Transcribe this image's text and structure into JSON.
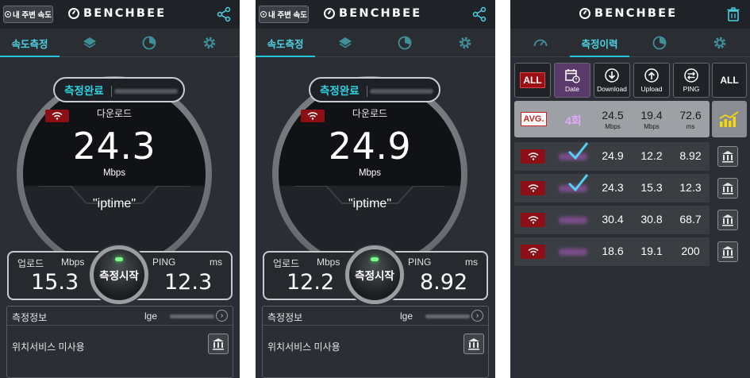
{
  "app": {
    "brand": "BENCHBEE"
  },
  "screens": [
    {
      "nearby_label": "내 주변 속도",
      "tab_speed": "속도측정",
      "badge_text": "측정완료",
      "download_label": "다운로드",
      "download_value": "24.3",
      "download_unit": "Mbps",
      "ssid": "\"iptime\"",
      "upload_label": "업로드",
      "upload_unit": "Mbps",
      "upload_value": "15.3",
      "ping_label": "PING",
      "ping_unit": "ms",
      "ping_value": "12.3",
      "start_label": "측정시작",
      "info_title": "측정정보",
      "info_device": "lge",
      "location_text": "위치서비스 미사용"
    },
    {
      "nearby_label": "내 주변 속도",
      "tab_speed": "속도측정",
      "badge_text": "측정완료",
      "download_label": "다운로드",
      "download_value": "24.9",
      "download_unit": "Mbps",
      "ssid": "\"iptime\"",
      "upload_label": "업로드",
      "upload_unit": "Mbps",
      "upload_value": "12.2",
      "ping_label": "PING",
      "ping_unit": "ms",
      "ping_value": "8.92",
      "start_label": "측정시작",
      "info_title": "측정정보",
      "info_device": "lge",
      "location_text": "위치서비스 미사용"
    }
  ],
  "history": {
    "tab_history": "측정이력",
    "filters": {
      "all_left": "ALL",
      "date": "Date",
      "download": "Download",
      "upload": "Upload",
      "ping": "PING",
      "all_right": "ALL"
    },
    "avg": {
      "tag": "AVG.",
      "count": "4회",
      "download": "24.5",
      "download_unit": "Mbps",
      "upload": "19.4",
      "upload_unit": "Mbps",
      "ping": "72.6",
      "ping_unit": "ms"
    },
    "rows": [
      {
        "download": "24.9",
        "upload": "12.2",
        "ping": "8.92",
        "checked": true
      },
      {
        "download": "24.3",
        "upload": "15.3",
        "ping": "12.3",
        "checked": true
      },
      {
        "download": "30.4",
        "upload": "30.8",
        "ping": "68.7",
        "checked": false
      },
      {
        "download": "18.6",
        "upload": "19.1",
        "ping": "200",
        "checked": false
      }
    ]
  },
  "colors": {
    "accent": "#26c6da",
    "wifi_badge": "#8b0f14",
    "background": "#2b2f35"
  }
}
